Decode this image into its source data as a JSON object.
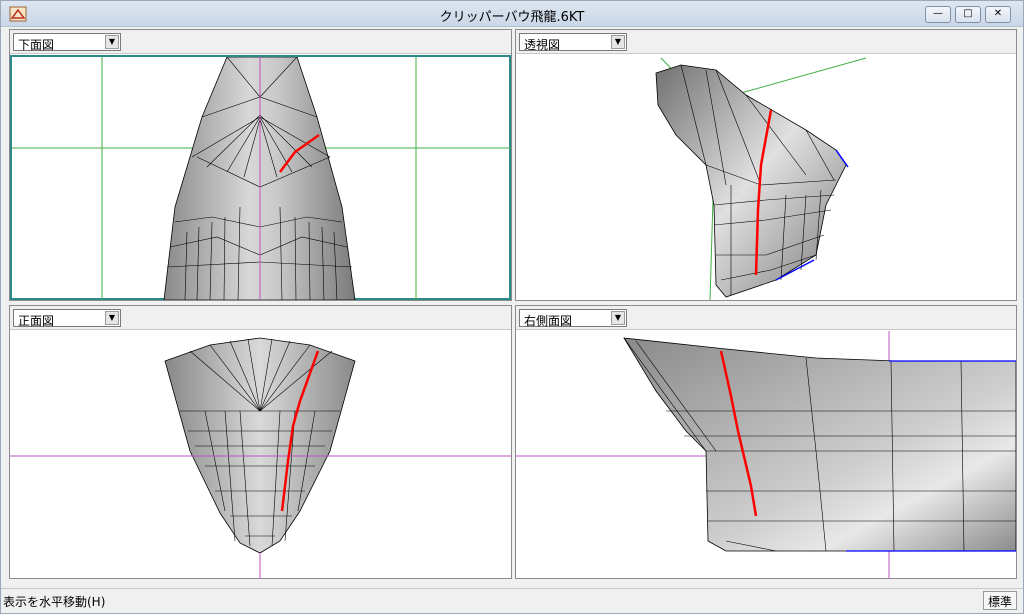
{
  "window": {
    "title": "クリッパーバウ飛龍.6KT"
  },
  "panes": {
    "bottom": {
      "view_label": "下面図"
    },
    "perspective": {
      "view_label": "透視図"
    },
    "front": {
      "view_label": "正面図"
    },
    "right": {
      "view_label": "右側面図"
    }
  },
  "status": {
    "text": "表示を水平移動(H)",
    "mode": "標準"
  },
  "colors": {
    "hull_line": "#000000",
    "highlight": "#ff0000",
    "axis_h": "#c050c0",
    "axis_g": "#40b040",
    "edge_blue": "#0000ff"
  }
}
